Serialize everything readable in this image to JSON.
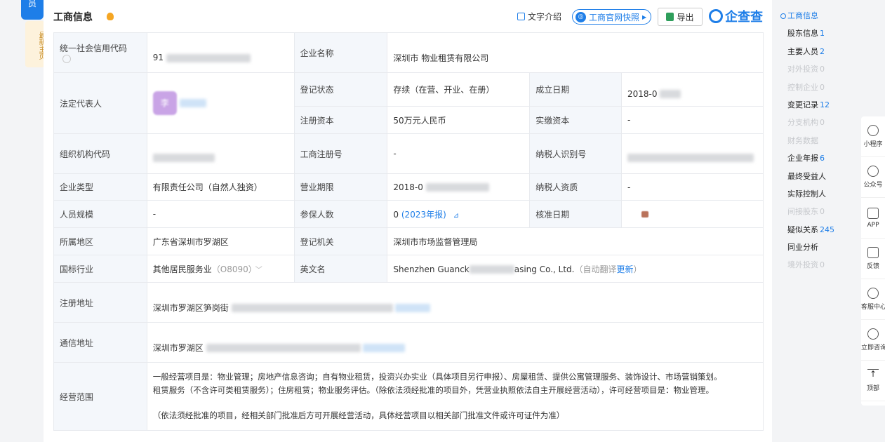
{
  "side_tab": {
    "top_label": "员",
    "vertical_label": "最新主页"
  },
  "header": {
    "title": "工商信息",
    "text_intro": "文字介绍",
    "snapshot": "工商官网快照",
    "export": "导出",
    "brand": "企查查"
  },
  "table": {
    "credit_code_label": "统一社会信用代码",
    "credit_code_value": "91",
    "company_name_label": "企业名称",
    "company_name_value": "深圳市 物业租赁有限公司",
    "legal_rep_label": "法定代表人",
    "avatar_text": "李",
    "reg_status_label": "登记状态",
    "reg_status_value": "存续（在营、开业、在册）",
    "found_date_label": "成立日期",
    "found_date_value": "2018-0",
    "reg_capital_label": "注册资本",
    "reg_capital_value": "50万元人民币",
    "paid_capital_label": "实缴资本",
    "paid_capital_value": "-",
    "org_code_label": "组织机构代码",
    "biz_reg_no_label": "工商注册号",
    "biz_reg_no_value": "-",
    "taxpayer_id_label": "纳税人识别号",
    "company_type_label": "企业类型",
    "company_type_value": "有限责任公司（自然人独资）",
    "biz_term_label": "营业期限",
    "biz_term_value": "2018-0",
    "taxpayer_qual_label": "纳税人资质",
    "taxpayer_qual_value": "-",
    "staff_size_label": "人员规模",
    "staff_size_value": "-",
    "insured_label": "参保人数",
    "insured_value": "0",
    "insured_year": "(2023年报)",
    "approve_date_label": "核准日期",
    "region_label": "所属地区",
    "region_value": "广东省深圳市罗湖区",
    "reg_authority_label": "登记机关",
    "reg_authority_value": "深圳市市场监督管理局",
    "industry_label": "国标行业",
    "industry_value": "其他居民服务业",
    "industry_code": "（O8090）",
    "english_name_label": "英文名",
    "english_name_prefix": "Shenzhen Guanck",
    "english_name_suffix": "asing Co., Ltd.",
    "auto_translate": "（自动翻译",
    "update_link": "更新",
    "auto_translate_end": "）",
    "reg_address_label": "注册地址",
    "reg_address_value": "深圳市罗湖区笋岗街",
    "mail_address_label": "通信地址",
    "mail_address_value": "深圳市罗湖区",
    "scope_label": "经营范围",
    "scope_line1": "一般经营项目是：物业管理；房地产信息咨询；自有物业租赁，投资兴办实业（具体项目另行申报）、房屋租赁、提供公寓管理服务、装饰设计、市场营销策划。",
    "scope_line2": "租赁服务（不含许可类租赁服务）；住房租赁；物业服务评估。（除依法须经批准的项目外，凭营业执照依法自主开展经营活动），许可经营项目是：物业管理。",
    "scope_line3": "（依法须经批准的项目，经相关部门批准后方可开展经营活动，具体经营项目以相关部门批准文件或许可证件为准）"
  },
  "right_nav": [
    {
      "label": "工商信息",
      "count": "",
      "state": "active"
    },
    {
      "label": "股东信息",
      "count": "1",
      "state": "normal"
    },
    {
      "label": "主要人员",
      "count": "2",
      "state": "normal"
    },
    {
      "label": "对外投资",
      "count": "0",
      "state": "dim"
    },
    {
      "label": "控制企业",
      "count": "0",
      "state": "dim"
    },
    {
      "label": "变更记录",
      "count": "12",
      "state": "normal"
    },
    {
      "label": "分支机构",
      "count": "0",
      "state": "dim"
    },
    {
      "label": "财务数据",
      "count": "",
      "state": "dim"
    },
    {
      "label": "企业年报",
      "count": "6",
      "state": "normal"
    },
    {
      "label": "最终受益人",
      "count": "",
      "state": "normal"
    },
    {
      "label": "实际控制人",
      "count": "",
      "state": "normal"
    },
    {
      "label": "间接股东",
      "count": "0",
      "state": "dim"
    },
    {
      "label": "疑似关系",
      "count": "245",
      "state": "normal"
    },
    {
      "label": "同业分析",
      "count": "",
      "state": "normal"
    },
    {
      "label": "境外投资",
      "count": "0",
      "state": "dim"
    }
  ],
  "toolbar": [
    {
      "label": "小程序",
      "icon": "mini-program-icon"
    },
    {
      "label": "公众号",
      "icon": "wechat-official-icon"
    },
    {
      "label": "APP",
      "icon": "app-icon"
    },
    {
      "label": "反馈",
      "icon": "feedback-icon"
    },
    {
      "label": "客服中心",
      "icon": "headset-icon"
    },
    {
      "label": "立即咨询",
      "icon": "chat-icon"
    },
    {
      "label": "顶部",
      "icon": "back-to-top-icon"
    }
  ],
  "colors": {
    "accent": "#1e7ee8",
    "label_bg": "#f4f7fb",
    "warning": "#f5a623"
  }
}
